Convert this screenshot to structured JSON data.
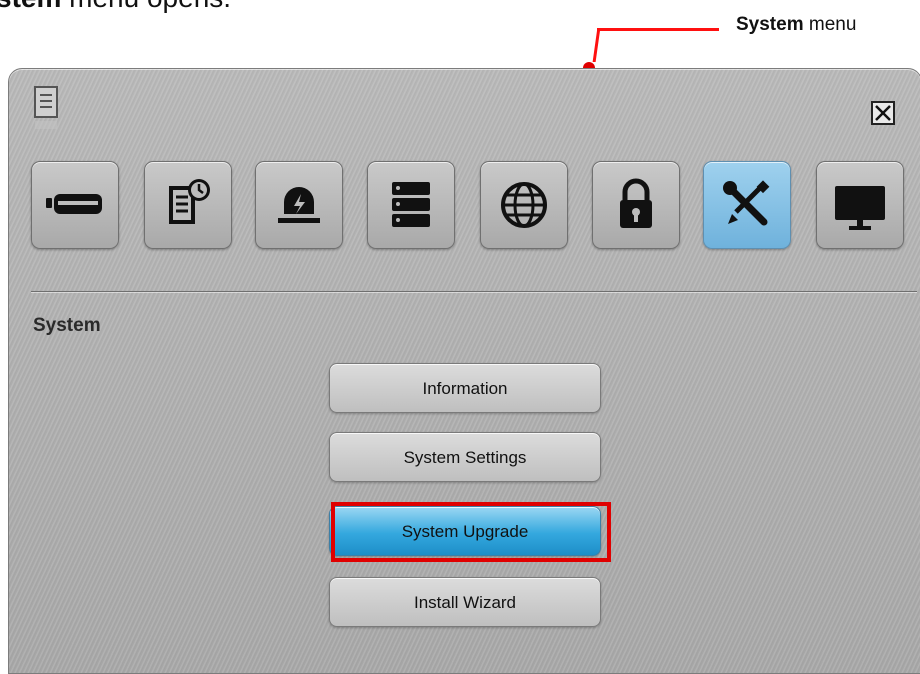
{
  "caption": {
    "bold": "stem",
    "rest": " menu opens."
  },
  "callout": {
    "bold": "System",
    "rest": " menu"
  },
  "tabs": [
    {
      "icon": "camera-icon"
    },
    {
      "icon": "schedule-record-icon"
    },
    {
      "icon": "alarm-icon"
    },
    {
      "icon": "storage-icon"
    },
    {
      "icon": "network-icon"
    },
    {
      "icon": "lock-icon"
    },
    {
      "icon": "tools-icon",
      "active": true
    },
    {
      "icon": "monitor-icon"
    }
  ],
  "section_title": "System",
  "buttons": [
    {
      "label": "Information"
    },
    {
      "label": "System Settings"
    },
    {
      "label": "System Upgrade",
      "active": true
    },
    {
      "label": "Install Wizard"
    }
  ],
  "colors": {
    "accent": "#34a8de",
    "highlight": "#e00000"
  }
}
